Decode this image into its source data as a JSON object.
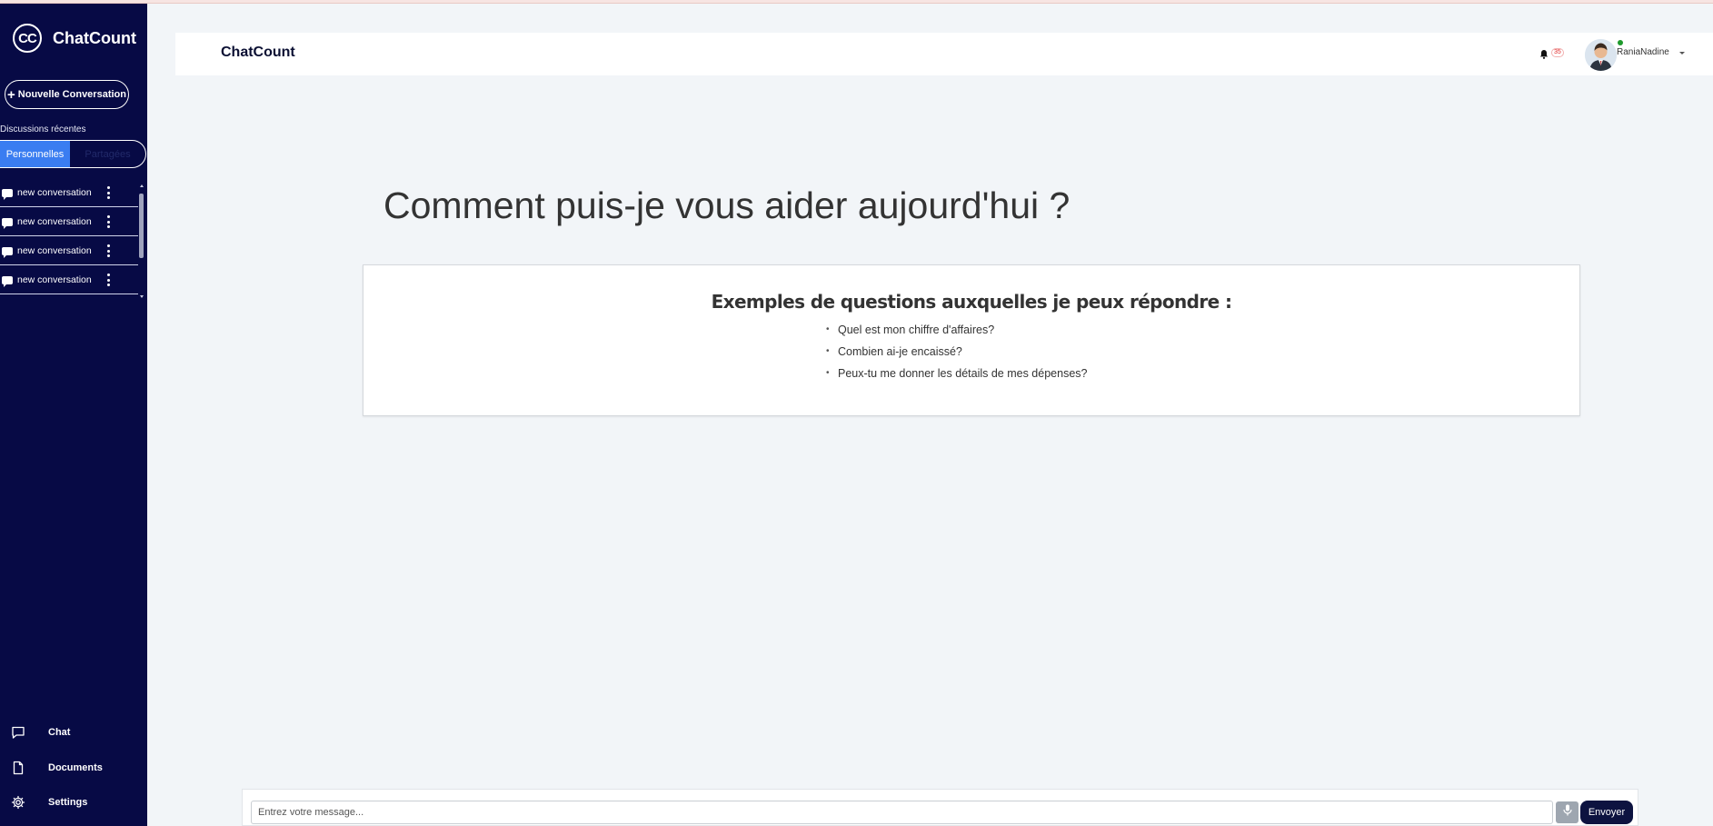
{
  "app": {
    "name": "ChatCount",
    "logo_text": "CC"
  },
  "sidebar": {
    "new_conversation_label": "Nouvelle Conversation",
    "recent_label": "Discussions récentes",
    "tabs": [
      {
        "label": "Personnelles",
        "active": true
      },
      {
        "label": "Partagées",
        "active": false
      }
    ],
    "conversations": [
      {
        "label": "new conversation"
      },
      {
        "label": "new conversation"
      },
      {
        "label": "new conversation"
      },
      {
        "label": "new conversation"
      }
    ],
    "nav": [
      {
        "label": "Chat",
        "icon": "chat-icon"
      },
      {
        "label": "Documents",
        "icon": "document-icon"
      },
      {
        "label": "Settings",
        "icon": "gear-icon"
      }
    ]
  },
  "header": {
    "logo": "ChatCount",
    "notification_count": "35",
    "user_name": "RaniaNadine",
    "user_status": "online"
  },
  "main": {
    "heading": "Comment puis-je vous aider aujourd'hui ?",
    "examples_title": "Exemples de questions auxquelles je peux répondre :",
    "examples": [
      "Quel est mon chiffre d'affaires?",
      "Combien ai-je encaissé?",
      "Peux-tu me donner les détails de mes dépenses?"
    ]
  },
  "composer": {
    "placeholder": "Entrez votre message...",
    "value": "",
    "send_label": "Envoyer"
  },
  "colors": {
    "sidebar_bg": "#070a45",
    "active_tab": "#3a7df1",
    "send_button": "#0d1340",
    "page_bg": "#f2f5f8"
  }
}
